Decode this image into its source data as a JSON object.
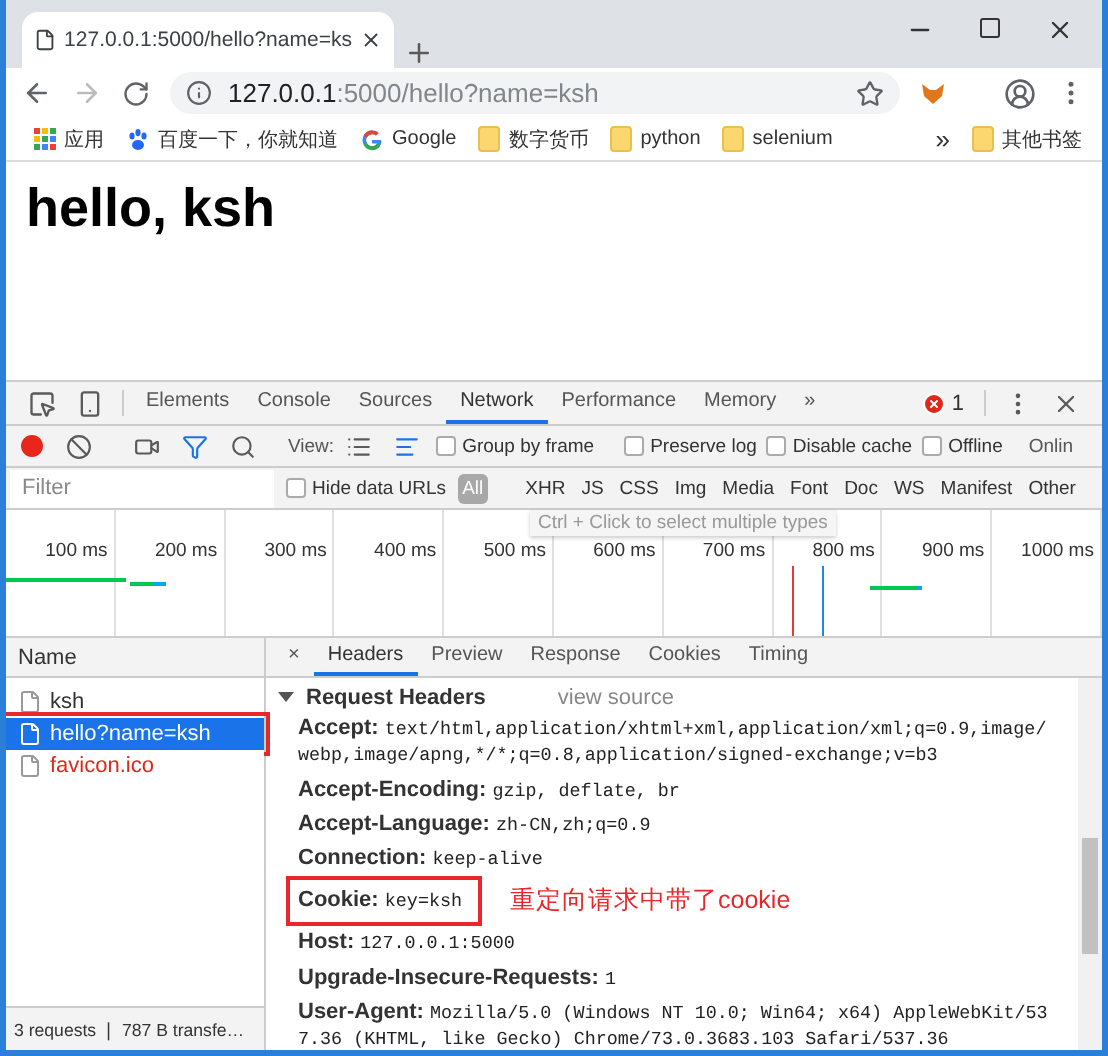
{
  "browser": {
    "tab": {
      "title": "127.0.0.1:5000/hello?name=ks"
    },
    "url": {
      "host": "127.0.0.1",
      "rest": ":5000/hello?name=ksh"
    },
    "bookmarks": [
      {
        "kind": "apps",
        "label": "应用"
      },
      {
        "kind": "paw",
        "label": "百度一下，你就知道"
      },
      {
        "kind": "google",
        "label": "Google"
      },
      {
        "kind": "folder",
        "label": "数字货币"
      },
      {
        "kind": "folder",
        "label": "python"
      },
      {
        "kind": "folder",
        "label": "selenium"
      }
    ],
    "bookmarks_more": "»",
    "other_bookmarks": "其他书签"
  },
  "page": {
    "heading": "hello, ksh"
  },
  "devtools": {
    "tabs": [
      {
        "label": "Elements",
        "selected": false
      },
      {
        "label": "Console",
        "selected": false
      },
      {
        "label": "Sources",
        "selected": false
      },
      {
        "label": "Network",
        "selected": true
      },
      {
        "label": "Performance",
        "selected": false
      },
      {
        "label": "Memory",
        "selected": false
      }
    ],
    "tabs_more": "»",
    "error_count": "1",
    "toolbar": {
      "view_label": "View:",
      "options": [
        {
          "label": "Group by frame",
          "checked": false
        },
        {
          "label": "Preserve log",
          "checked": false
        },
        {
          "label": "Disable cache",
          "checked": false
        },
        {
          "label": "Offline",
          "checked": false
        }
      ],
      "throttle": "Onlin"
    },
    "filter": {
      "placeholder": "Filter",
      "hide_data_urls": {
        "label": "Hide data URLs",
        "checked": false
      },
      "types": [
        {
          "label": "All",
          "selected": true
        },
        {
          "label": "XHR",
          "selected": false
        },
        {
          "label": "JS",
          "selected": false
        },
        {
          "label": "CSS",
          "selected": false
        },
        {
          "label": "Img",
          "selected": false
        },
        {
          "label": "Media",
          "selected": false
        },
        {
          "label": "Font",
          "selected": false
        },
        {
          "label": "Doc",
          "selected": false
        },
        {
          "label": "WS",
          "selected": false
        },
        {
          "label": "Manifest",
          "selected": false
        },
        {
          "label": "Other",
          "selected": false
        }
      ]
    },
    "overview": {
      "ticks": [
        "100 ms",
        "200 ms",
        "300 ms",
        "400 ms",
        "500 ms",
        "600 ms",
        "700 ms",
        "800 ms",
        "900 ms",
        "1000 ms"
      ],
      "tooltip": "Ctrl + Click to select multiple types"
    },
    "requests": {
      "header": "Name",
      "rows": [
        {
          "name": "ksh",
          "selected": false,
          "error": false,
          "highlighted": false
        },
        {
          "name": "hello?name=ksh",
          "selected": true,
          "error": false,
          "highlighted": true
        },
        {
          "name": "favicon.ico",
          "selected": false,
          "error": true,
          "highlighted": false
        }
      ],
      "status": "3 requests ❘ 787 B transfe…"
    },
    "details": {
      "close": "×",
      "tabs": [
        {
          "label": "Headers",
          "selected": true
        },
        {
          "label": "Preview",
          "selected": false
        },
        {
          "label": "Response",
          "selected": false
        },
        {
          "label": "Cookies",
          "selected": false
        },
        {
          "label": "Timing",
          "selected": false
        }
      ],
      "section": {
        "title": "Request Headers",
        "expanded": true,
        "link": "view source"
      },
      "headers": [
        {
          "name": "Accept:",
          "value": "text/html,application/xhtml+xml,application/xml;q=0.9,image/webp,image/apng,*/*;q=0.8,application/signed-exchange;v=b3",
          "highlighted": false
        },
        {
          "name": "Accept-Encoding:",
          "value": "gzip, deflate, br",
          "highlighted": false
        },
        {
          "name": "Accept-Language:",
          "value": "zh-CN,zh;q=0.9",
          "highlighted": false
        },
        {
          "name": "Connection:",
          "value": "keep-alive",
          "highlighted": false
        },
        {
          "name": "Cookie:",
          "value": "key=ksh",
          "highlighted": true,
          "note": "重定向请求中带了cookie"
        },
        {
          "name": "Host:",
          "value": "127.0.0.1:5000",
          "highlighted": false
        },
        {
          "name": "Upgrade-Insecure-Requests:",
          "value": "1",
          "highlighted": false
        },
        {
          "name": "User-Agent:",
          "value": "Mozilla/5.0 (Windows NT 10.0; Win64; x64) AppleWebKit/537.36 (KHTML, like Gecko) Chrome/73.0.3683.103 Safari/537.36",
          "highlighted": false
        }
      ]
    }
  }
}
